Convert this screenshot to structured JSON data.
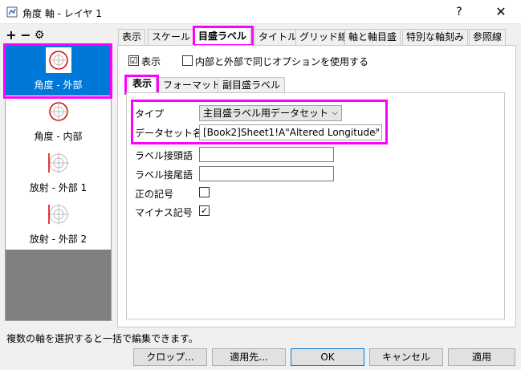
{
  "window": {
    "title": "角度 軸 - レイヤ 1",
    "help": "?",
    "close": "✕"
  },
  "toolbar": {
    "add": "+",
    "remove": "−",
    "settings": "⚙"
  },
  "axes": [
    {
      "label": "角度 - 外部",
      "selected": true
    },
    {
      "label": "角度 - 内部",
      "selected": false
    },
    {
      "label": "放射 - 外部 1",
      "selected": false
    },
    {
      "label": "放射 - 外部 2",
      "selected": false
    }
  ],
  "tabs": [
    {
      "label": "表示"
    },
    {
      "label": "スケール"
    },
    {
      "label": "目盛ラベル",
      "active": true
    },
    {
      "label": "タイトル"
    },
    {
      "label": "グリッド線"
    },
    {
      "label": "軸と軸目盛"
    },
    {
      "label": "特別な軸刻み"
    },
    {
      "label": "参照線"
    }
  ],
  "options": {
    "show_label": "表示",
    "show_checked": "☑",
    "same_options_label": "内部と外部で同じオプションを使用する"
  },
  "subtabs": [
    {
      "label": "表示",
      "active": true
    },
    {
      "label": "フォーマット"
    },
    {
      "label": "副目盛ラベル"
    }
  ],
  "form": {
    "type_label": "タイプ",
    "type_value": "主目盛ラベル用データセット",
    "dataset_label": "データセット名",
    "dataset_value": "[Book2]Sheet1!A\"Altered Longitude\"",
    "prefix_label": "ラベル接頭語",
    "prefix_value": "",
    "suffix_label": "ラベル接尾語",
    "suffix_value": "",
    "plus_sign_label": "正の記号",
    "plus_sign_checked": false,
    "minus_sign_label": "マイナス記号",
    "minus_sign_checked": true,
    "check_mark": "✓"
  },
  "status": "複数の軸を選択すると一括で編集できます。",
  "buttons": {
    "crop": "クロップ...",
    "apply_to": "適用先...",
    "ok": "OK",
    "cancel": "キャンセル",
    "apply": "適用"
  },
  "colors": {
    "selection": "#0078d7",
    "highlight": "#ff00ff",
    "axis_icon": "#d40000"
  }
}
